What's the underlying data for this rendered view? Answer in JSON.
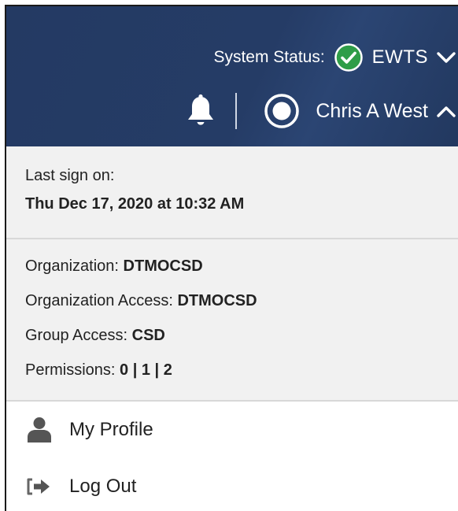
{
  "header": {
    "status_label": "System Status:",
    "status_state": "ok",
    "system_name": "EWTS",
    "user_name": "Chris A West"
  },
  "colors": {
    "header_bg": "#243a63",
    "status_ok": "#2f9d48",
    "panel_bg": "#f1f1f1",
    "icon_gray": "#555555"
  },
  "icons": {
    "status": "check-circle",
    "system_toggle": "chevron-down",
    "notifications": "bell",
    "user": "user-circle",
    "user_toggle": "chevron-up",
    "profile": "person",
    "logout": "sign-out"
  },
  "panel": {
    "last_sign_on_label": "Last sign on:",
    "last_sign_on_value": "Thu Dec 17, 2020 at 10:32 AM",
    "organization_label": "Organization:",
    "organization_value": "DTMOCSD",
    "organization_access_label": "Organization Access:",
    "organization_access_value": "DTMOCSD",
    "group_access_label": "Group Access:",
    "group_access_value": "CSD",
    "permissions_label": "Permissions:",
    "permissions_value": "0 | 1 | 2"
  },
  "menu": {
    "profile_label": "My Profile",
    "logout_label": "Log Out"
  }
}
